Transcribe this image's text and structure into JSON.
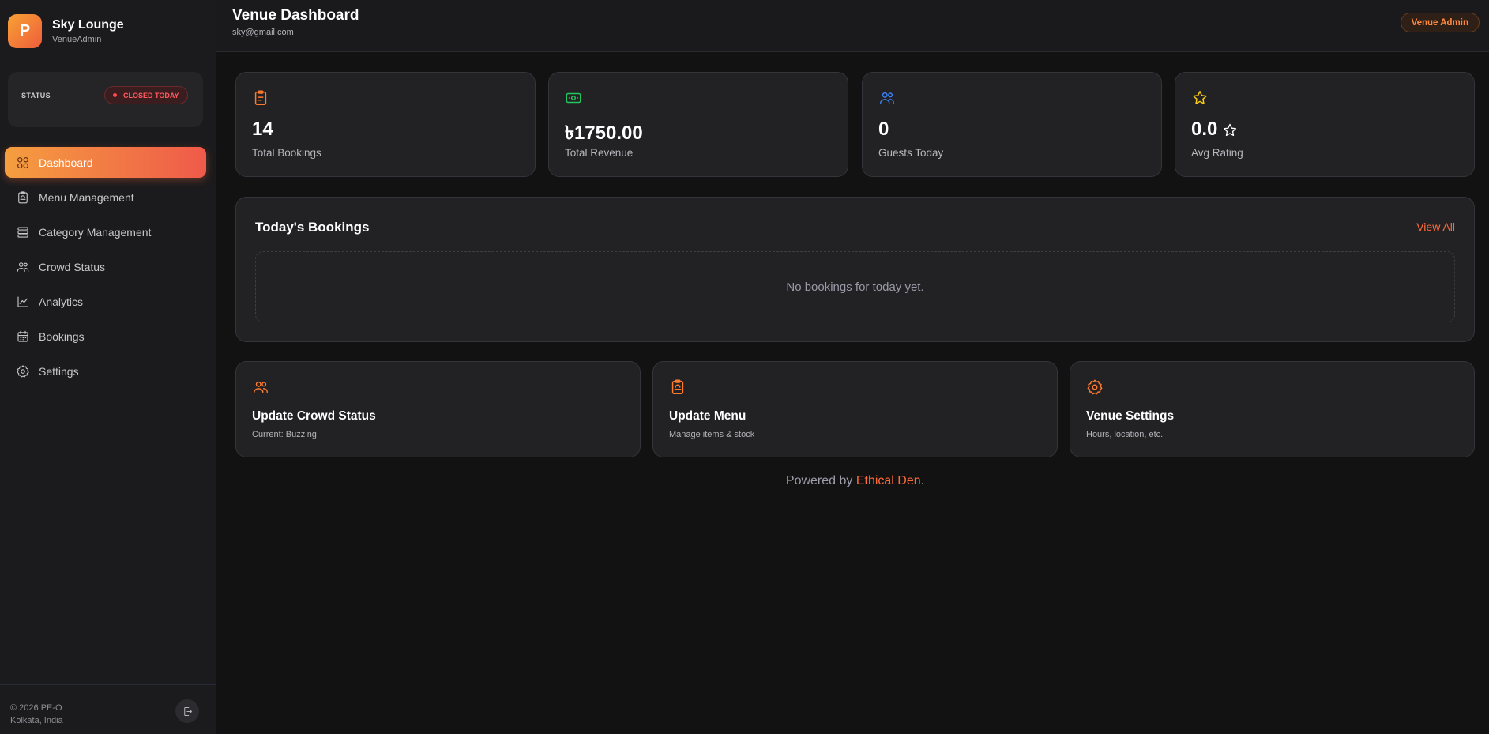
{
  "sidebar": {
    "logo_letter": "P",
    "brand_name": "Sky Lounge",
    "brand_sub": "VenueAdmin",
    "status_label": "STATUS",
    "status_badge": "CLOSED TODAY",
    "nav": [
      {
        "label": "Dashboard",
        "icon": "grid-icon",
        "active": true
      },
      {
        "label": "Menu Management",
        "icon": "clipboard-icon",
        "active": false
      },
      {
        "label": "Category Management",
        "icon": "layers-icon",
        "active": false
      },
      {
        "label": "Crowd Status",
        "icon": "users-icon",
        "active": false
      },
      {
        "label": "Analytics",
        "icon": "chart-line-icon",
        "active": false
      },
      {
        "label": "Bookings",
        "icon": "calendar-icon",
        "active": false
      },
      {
        "label": "Settings",
        "icon": "gear-icon",
        "active": false
      }
    ],
    "footer_copy": "© 2026 PE-O",
    "footer_location": "Kolkata, India"
  },
  "header": {
    "title": "Venue Dashboard",
    "email": "sky@gmail.com",
    "role_badge": "Venue Admin"
  },
  "stats": [
    {
      "value": "14",
      "label": "Total Bookings",
      "icon": "clipboard-icon",
      "color": "#ff7a2e"
    },
    {
      "value": "৳1750.00",
      "label": "Total Revenue",
      "icon": "banknote-icon",
      "color": "#22c55e"
    },
    {
      "value": "0",
      "label": "Guests Today",
      "icon": "users-icon",
      "color": "#3b82f6"
    },
    {
      "value": "0.0",
      "label": "Avg Rating",
      "icon": "star-icon",
      "color": "#facc15"
    }
  ],
  "bookings": {
    "title": "Today's Bookings",
    "view_all": "View All",
    "empty_text": "No bookings for today yet."
  },
  "actions": [
    {
      "title": "Update Crowd Status",
      "subtitle": "Current: Buzzing",
      "icon": "users-icon"
    },
    {
      "title": "Update Menu",
      "subtitle": "Manage items & stock",
      "icon": "menu-board-icon"
    },
    {
      "title": "Venue Settings",
      "subtitle": "Hours, location, etc.",
      "icon": "gear-icon"
    }
  ],
  "footer": {
    "powered_prefix": "Powered by ",
    "powered_brand": "Ethical Den",
    "powered_suffix": "."
  },
  "colors": {
    "accent": "#ff6a3a",
    "accent_gradient_start": "#f59e3f",
    "accent_gradient_end": "#ef5a4a",
    "closed": "#ff5a5f"
  }
}
